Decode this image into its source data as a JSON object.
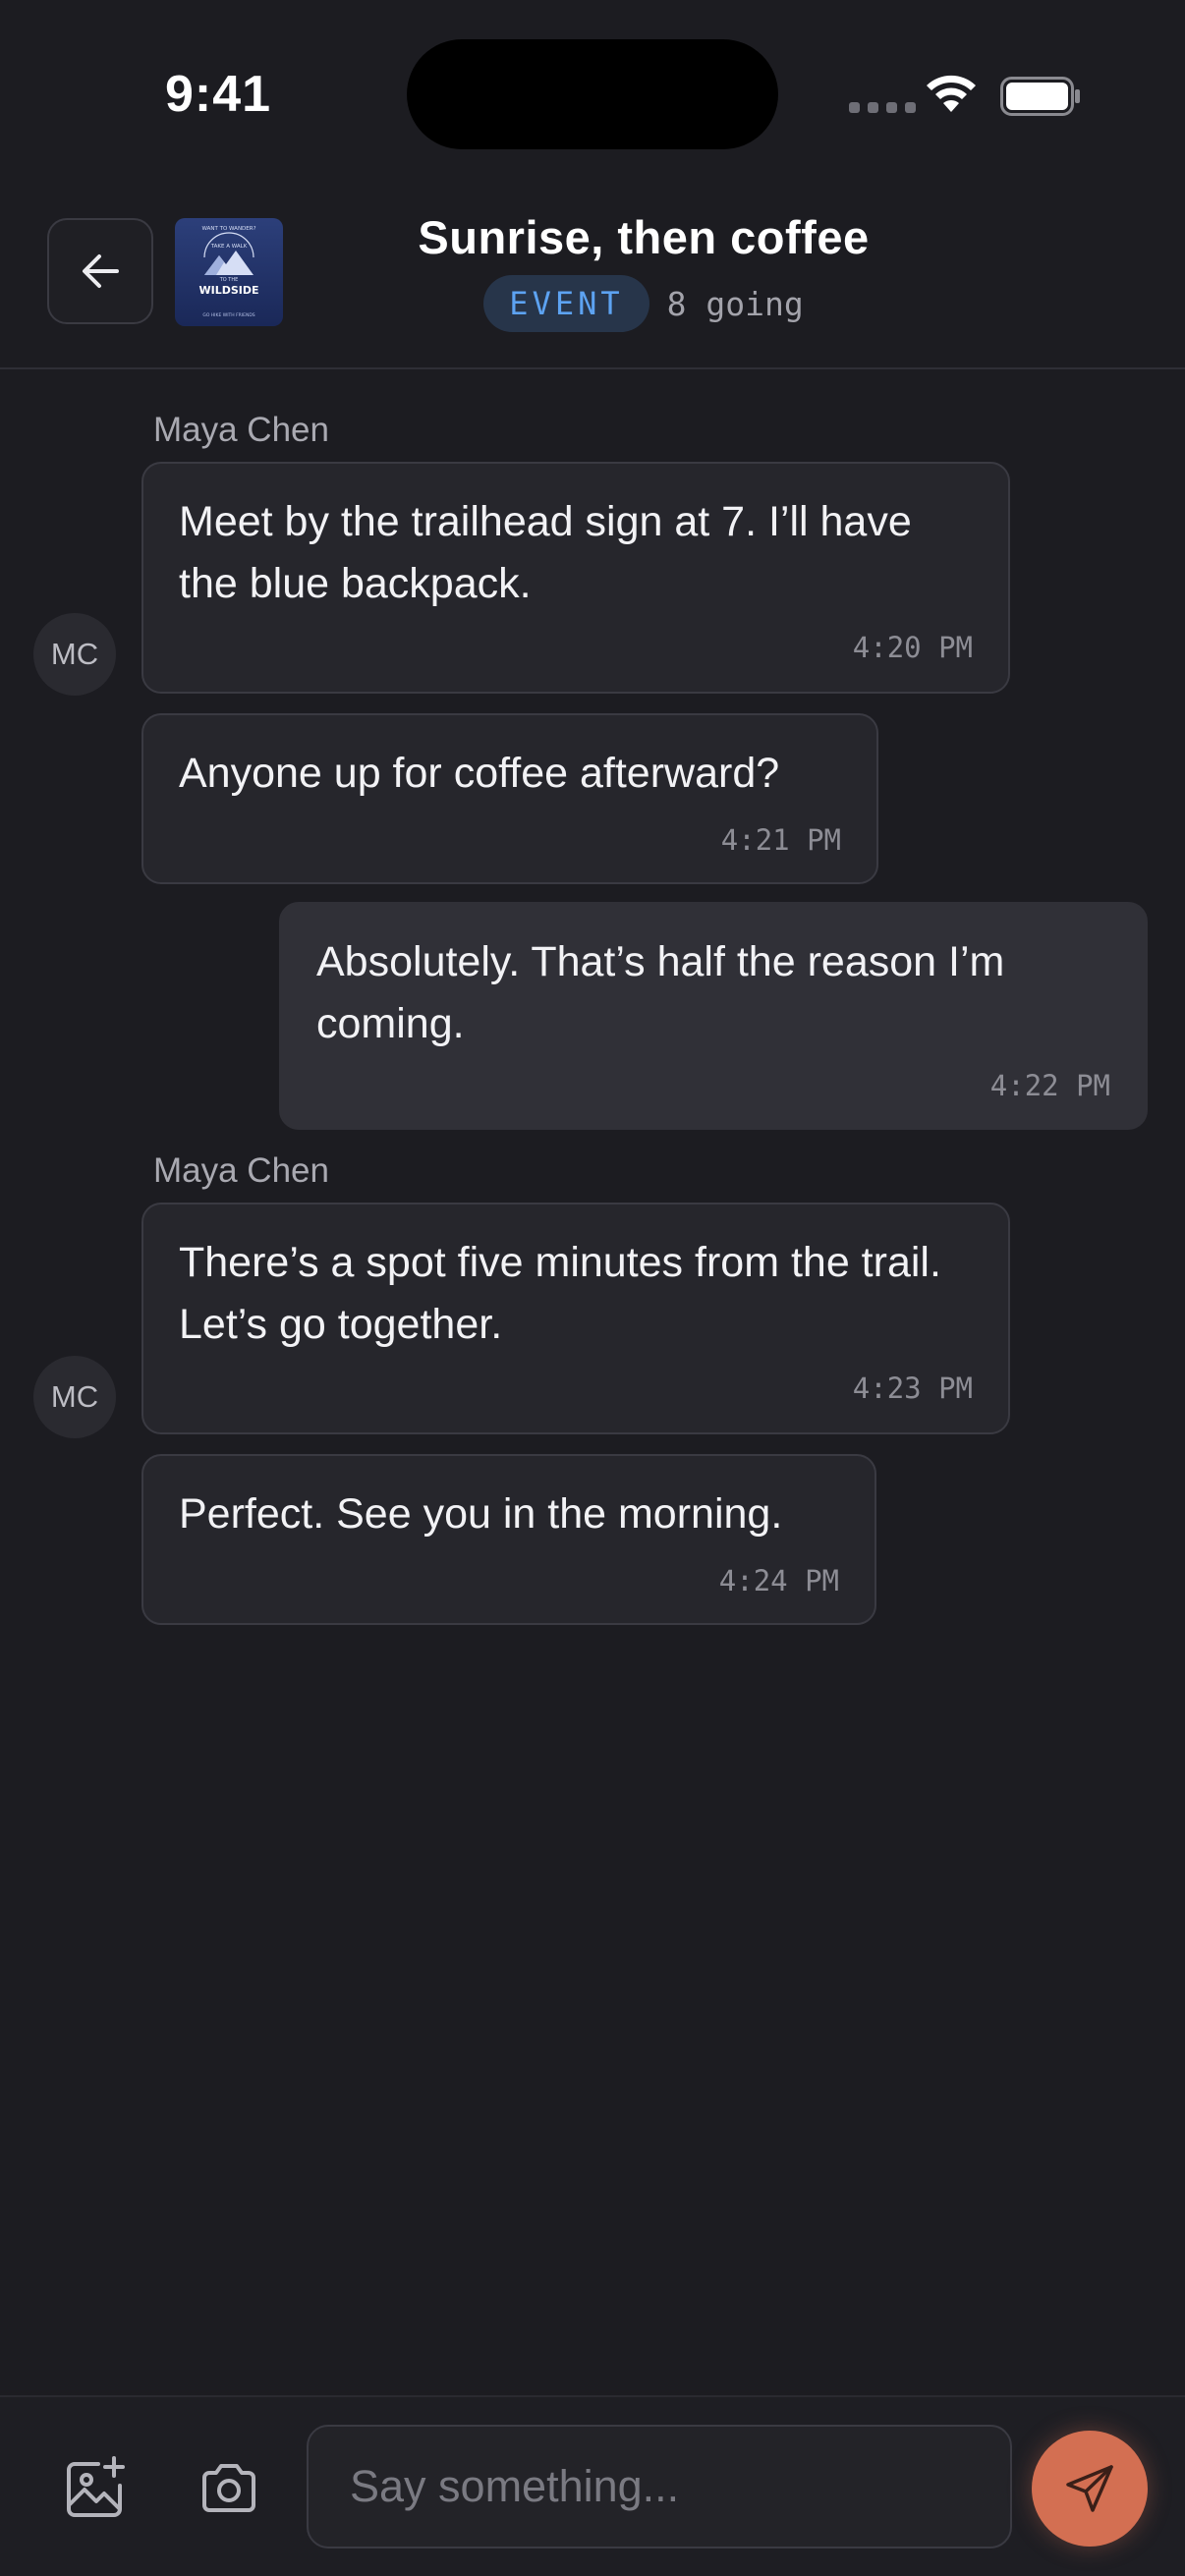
{
  "status_bar": {
    "time": "9:41"
  },
  "header": {
    "title": "Sunrise, then coffee",
    "badge": "EVENT",
    "going": "8 going",
    "thumbnail_text": {
      "top": "WANT TO WANDER?",
      "middle": "TAKE A WALK",
      "sub": "TO THE",
      "main": "WILDSIDE",
      "bottom": "GO HIKE WITH FRIENDS"
    }
  },
  "messages": [
    {
      "sender": "Maya Chen",
      "avatar": "MC",
      "text": "Meet by the trailhead sign at 7. I’ll have the blue backpack.",
      "time": "4:20 PM",
      "mine": false
    },
    {
      "sender": "",
      "text": "Anyone up for coffee afterward?",
      "time": "4:21 PM",
      "mine": false
    },
    {
      "sender": "",
      "text": "Absolutely. That’s half the reason I’m coming.",
      "time": "4:22 PM",
      "mine": true
    },
    {
      "sender": "Maya Chen",
      "avatar": "MC",
      "text": "There’s a spot five minutes from the trail. Let’s go together.",
      "time": "4:23 PM",
      "mine": false
    },
    {
      "sender": "",
      "text": "Perfect. See you in the morning.",
      "time": "4:24 PM",
      "mine": false
    }
  ],
  "composer": {
    "placeholder": "Say something..."
  },
  "icons": {
    "back": "arrow-left-icon",
    "gallery": "image-plus-icon",
    "camera": "camera-icon",
    "send": "send-icon",
    "wifi": "wifi-icon",
    "battery": "battery-icon"
  },
  "colors": {
    "background": "#1c1c21",
    "bubble": "#26262c",
    "bubble_mine": "#303037",
    "accent_badge": "#5da3f2",
    "send": "#d36f52"
  }
}
